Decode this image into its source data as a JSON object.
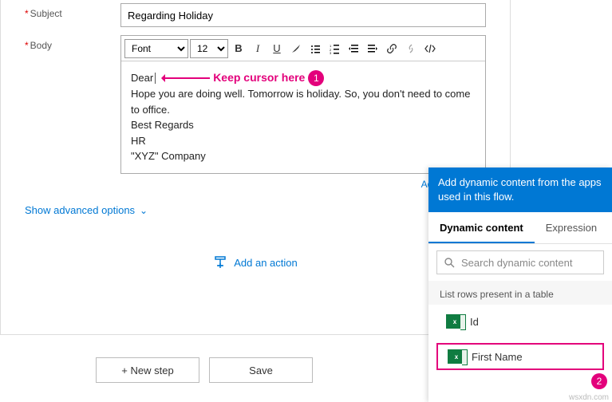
{
  "fields": {
    "subject_label": "Subject",
    "subject_value": "Regarding Holiday",
    "body_label": "Body"
  },
  "toolbar": {
    "font_label": "Font",
    "size_label": "12"
  },
  "editor": {
    "dear": "Dear",
    "annotation": "Keep cursor here",
    "badge1": "1",
    "line2": "Hope you are doing well. Tomorrow is holiday. So, you don't need to come to office.",
    "line3": "Best Regards",
    "line4": "HR",
    "line5": "\"XYZ\" Company"
  },
  "links": {
    "add_dynamic": "Add dynamic",
    "advanced": "Show advanced options",
    "add_action": "Add an action"
  },
  "buttons": {
    "new_step": "+ New step",
    "save": "Save"
  },
  "panel": {
    "header": "Add dynamic content from the apps used in this flow.",
    "tab1": "Dynamic content",
    "tab2": "Expression",
    "search_placeholder": "Search dynamic content",
    "section": "List rows present in a table",
    "chip_id": "Id",
    "chip_first": "First Name",
    "badge2": "2"
  },
  "watermark": "wsxdn.com"
}
